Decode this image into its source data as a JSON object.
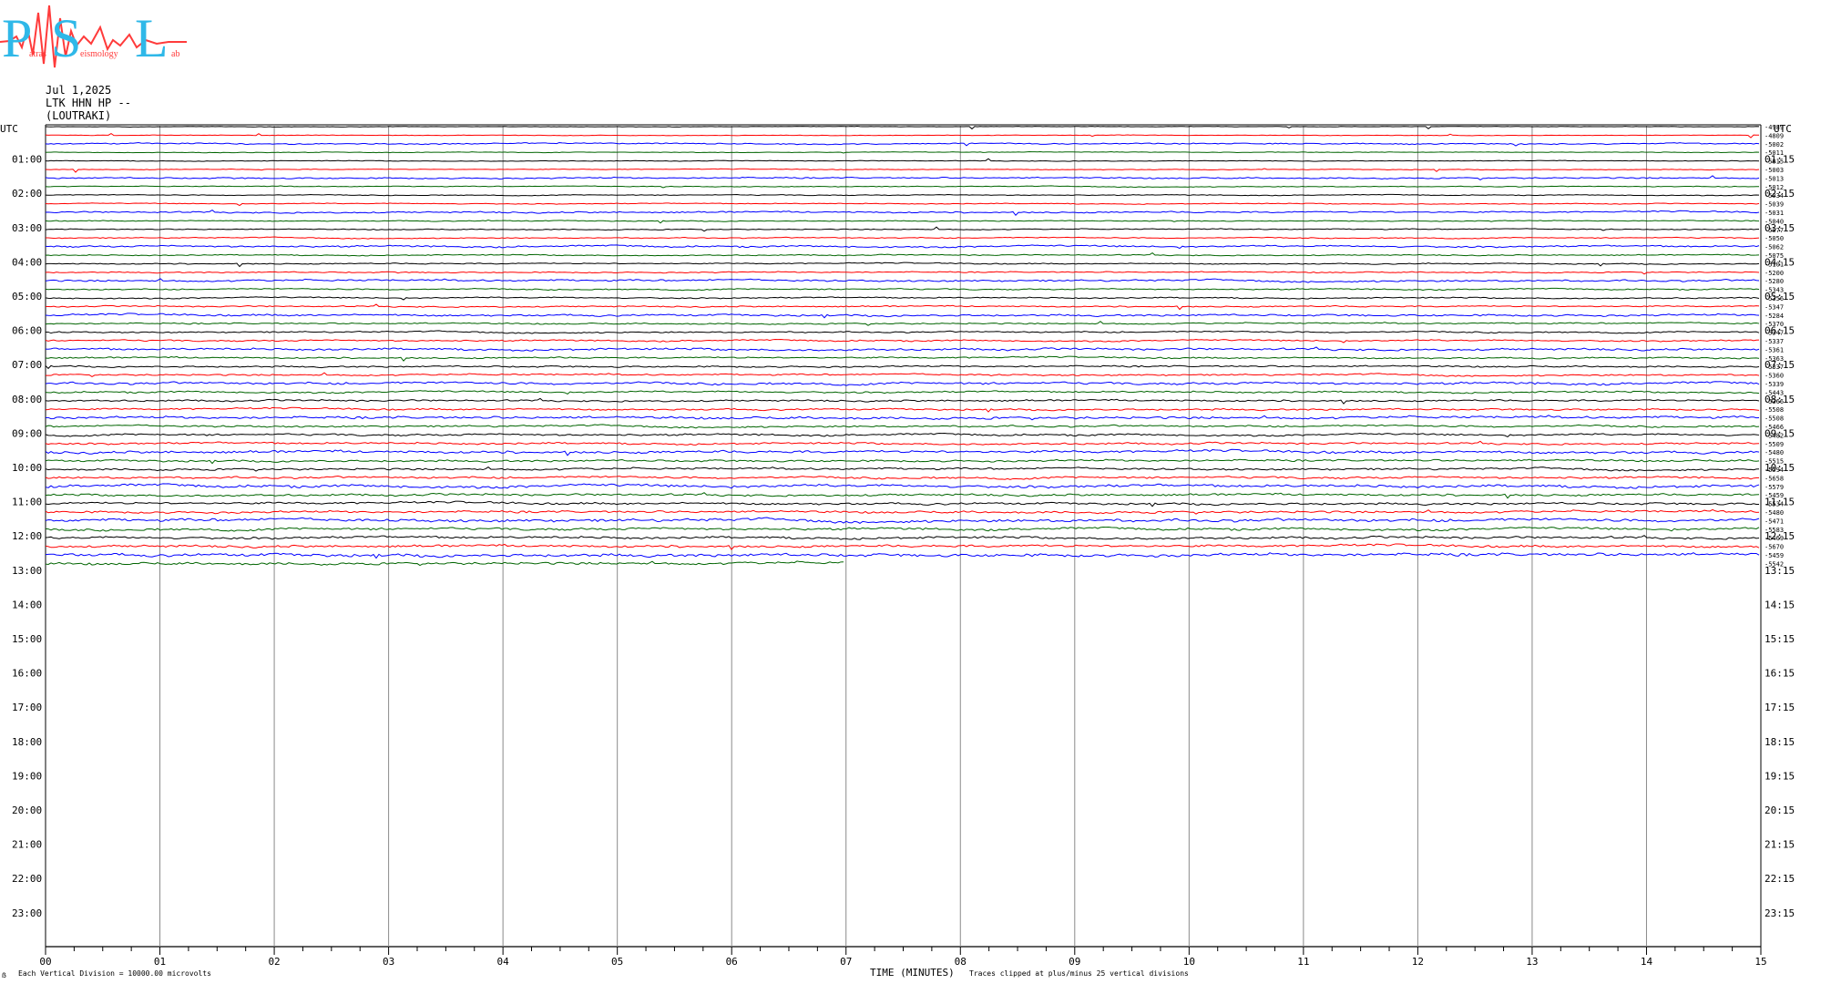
{
  "logo": {
    "letters": [
      "P",
      "S",
      "L"
    ],
    "small_words": [
      "atras",
      "eismology",
      "ab"
    ],
    "colors": {
      "letters": "#2fb8e8",
      "wave": "#ff3b3b"
    }
  },
  "header": {
    "date": "Jul 1,2025",
    "station": "LTK HHN HP --",
    "location": "(LOUTRAKI)"
  },
  "footer": {
    "left_note": "Each Vertical Division = 10000.00 microvolts",
    "center_label": "TIME (MINUTES)",
    "center_note": "Traces clipped at plus/minus 25 vertical divisions",
    "corner_mark": "ẞ"
  },
  "chart_data": {
    "type": "line",
    "title": "",
    "xlabel": "TIME (MINUTES)",
    "xlim": [
      0,
      15
    ],
    "x_ticks": [
      "00",
      "01",
      "02",
      "03",
      "04",
      "05",
      "06",
      "07",
      "08",
      "09",
      "10",
      "11",
      "12",
      "13",
      "14",
      "15"
    ],
    "x_minor_tick_interval": 0.25,
    "grid_vertical_every": 1,
    "utc_label": "UTC",
    "left_hours": [
      "01:00",
      "02:00",
      "03:00",
      "04:00",
      "05:00",
      "06:00",
      "07:00",
      "08:00",
      "09:00",
      "10:00",
      "11:00",
      "12:00",
      "13:00",
      "14:00",
      "15:00",
      "16:00",
      "17:00",
      "18:00",
      "19:00",
      "20:00",
      "21:00",
      "22:00",
      "23:00"
    ],
    "right_hours": [
      "01:15",
      "02:15",
      "03:15",
      "04:15",
      "05:15",
      "06:15",
      "07:15",
      "08:15",
      "09:15",
      "10:15",
      "11:15",
      "12:15",
      "13:15",
      "14:15",
      "15:15",
      "16:15",
      "17:15",
      "18:15",
      "19:15",
      "20:15",
      "21:15",
      "22:15",
      "23:15"
    ],
    "trace_colors": [
      "#000000",
      "#ff0000",
      "#0000ff",
      "#006400"
    ],
    "trace_count": 52,
    "last_trace_end_minute": 7.0,
    "trace_offsets": [
      "-4989",
      "-4809",
      "-5002",
      "-5011",
      "-5015",
      "-5003",
      "-5013",
      "-5012",
      "-5034",
      "-5039",
      "-5031",
      "-5040",
      "-5077",
      "-5050",
      "-5062",
      "-5075",
      "-5101",
      "-5200",
      "-5280",
      "-5343",
      "-5356",
      "-5347",
      "-5284",
      "-5370",
      "-5347",
      "-5337",
      "-5361",
      "-5363",
      "-5337",
      "-5360",
      "-5339",
      "-5443",
      "-5366",
      "-5508",
      "-5508",
      "-5466",
      "-5482",
      "-5509",
      "-5480",
      "-5515",
      "-5594",
      "-5658",
      "-5579",
      "-5459",
      "-5534",
      "-5480",
      "-5471",
      "-5583",
      "-5469",
      "-5670",
      "-5459",
      "-5542"
    ]
  }
}
